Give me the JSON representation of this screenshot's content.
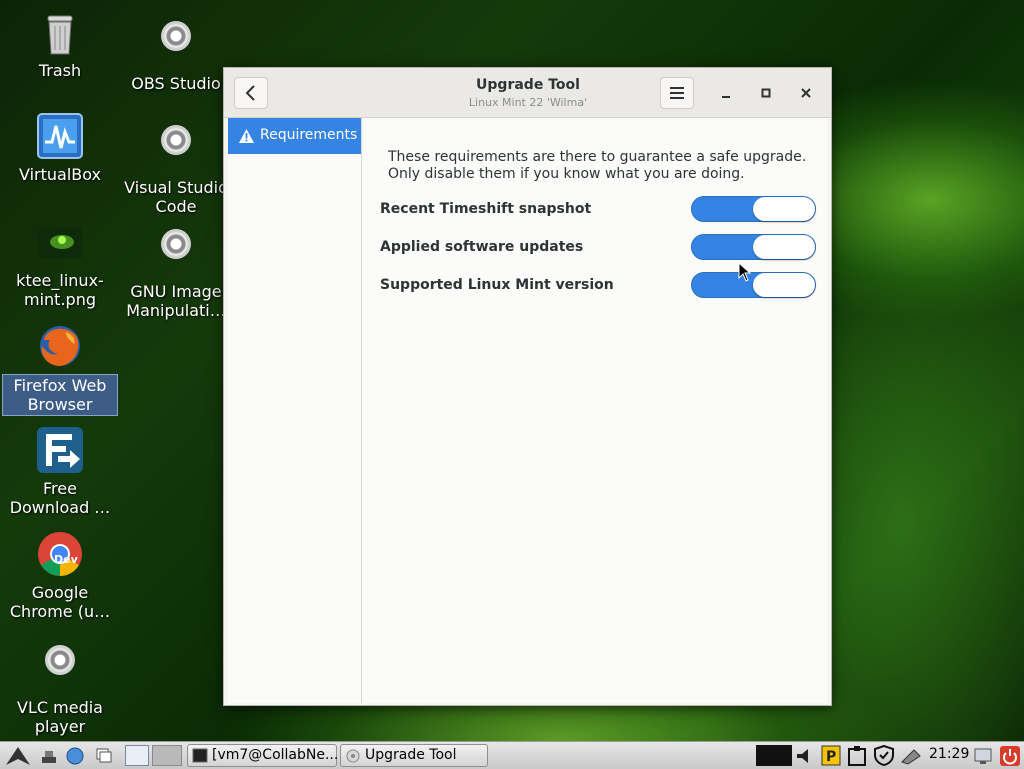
{
  "desktop": {
    "icons": [
      {
        "label": "Trash"
      },
      {
        "label": "OBS Studio"
      },
      {
        "label": "VirtualBox"
      },
      {
        "label": "Visual Studio Code"
      },
      {
        "label": "ktee_linux-mint.png"
      },
      {
        "label": "GNU Image Manipulati…"
      },
      {
        "label": "Firefox Web Browser"
      },
      {
        "label": "Free Download …"
      },
      {
        "label": "Google Chrome (u…"
      },
      {
        "label": "VLC media player"
      }
    ],
    "chrome_badge": "Dev"
  },
  "window": {
    "title": "Upgrade Tool",
    "subtitle": "Linux Mint 22 'Wilma'",
    "sidebar": {
      "items": [
        {
          "label": "Requirements",
          "icon": "warning-icon"
        }
      ]
    },
    "intro": "These requirements are there to guarantee a safe upgrade. Only disable them if you know what you are doing.",
    "requirements": [
      {
        "label": "Recent Timeshift snapshot",
        "enabled": true
      },
      {
        "label": "Applied software updates",
        "enabled": true
      },
      {
        "label": "Supported Linux Mint version",
        "enabled": true
      }
    ]
  },
  "taskbar": {
    "windows": [
      {
        "label": "[vm7@CollabNe..."
      },
      {
        "label": "Upgrade Tool"
      }
    ],
    "clock": "21:29"
  },
  "colors": {
    "accent": "#3584e4",
    "panel": "#d6d6d6"
  }
}
